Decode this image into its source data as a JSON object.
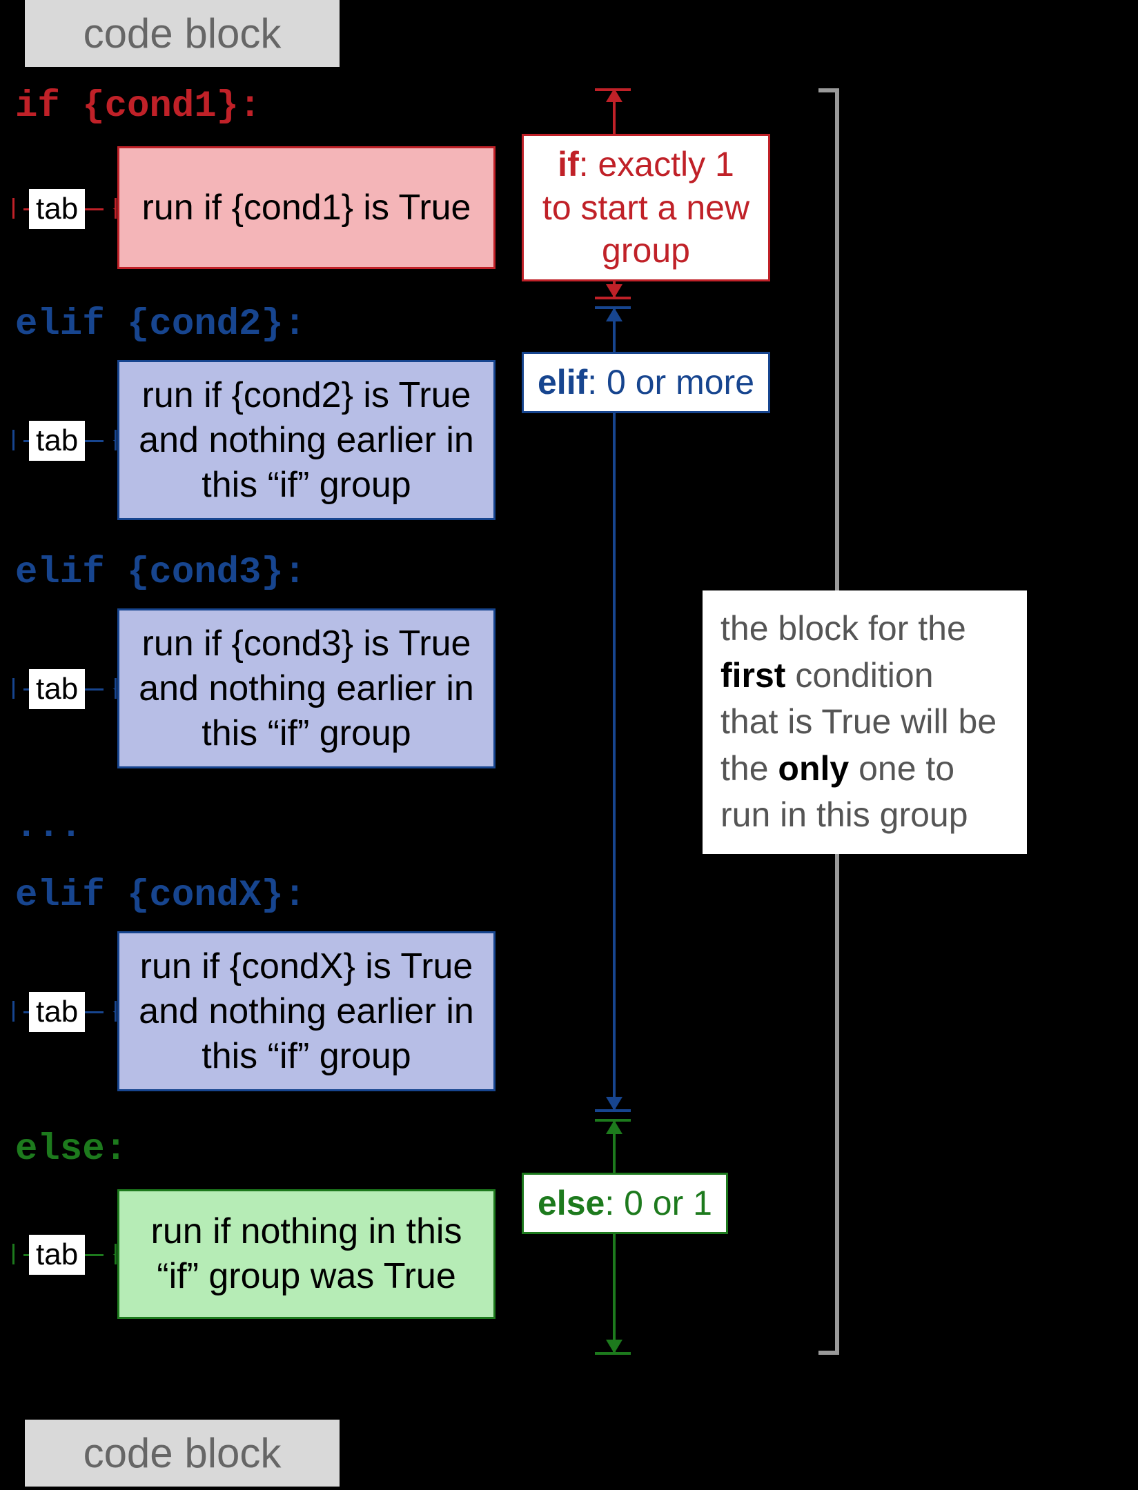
{
  "colors": {
    "red": "#c02128",
    "blue": "#17458f",
    "green": "#1d7a1d",
    "red_fill": "#f4b5b8",
    "blue_fill": "#b7bee6",
    "green_fill": "#b6ecb6"
  },
  "codeblock_top": "code block",
  "codeblock_bottom": "code block",
  "tab_label": "tab",
  "ellipsis": "...",
  "if_line": {
    "kw": "if",
    "rest": " {cond1}:"
  },
  "elif2_line": {
    "kw": "elif",
    "rest": " {cond2}:"
  },
  "elif3_line": {
    "kw": "elif",
    "rest": " {cond3}:"
  },
  "elifX_line": {
    "kw": "elif",
    "rest": " {condX}:"
  },
  "else_line": {
    "kw": "else",
    "rest": ":"
  },
  "box_if": "run if {cond1} is True",
  "box_elif2_l1": "run if {cond2} is True",
  "box_elif2_l2": "and nothing earlier in",
  "box_elif2_l3": "this “if” group",
  "box_elif3_l1": "run if {cond3} is True",
  "box_elif3_l2": "and nothing earlier in",
  "box_elif3_l3": "this “if” group",
  "box_elifX_l1": "run if {condX} is True",
  "box_elifX_l2": "and nothing earlier in",
  "box_elifX_l3": "this “if” group",
  "box_else_l1": "run if nothing in this",
  "box_else_l2": "“if” group was True",
  "side_if_kw": "if",
  "side_if_rest": ": exactly 1",
  "side_if_l2": "to start a new",
  "side_if_l3": "group",
  "side_elif_kw": "elif",
  "side_elif_rest": ": 0 or more",
  "side_else_kw": "else",
  "side_else_rest": ": 0 or 1",
  "overall_l1": "the block for the",
  "overall_first": "first",
  "overall_l2_rest": " condition",
  "overall_l3": "that is True will be",
  "overall_l4_pre": "the ",
  "overall_only": "only",
  "overall_l4_post": " one to",
  "overall_l5": "run in this group"
}
